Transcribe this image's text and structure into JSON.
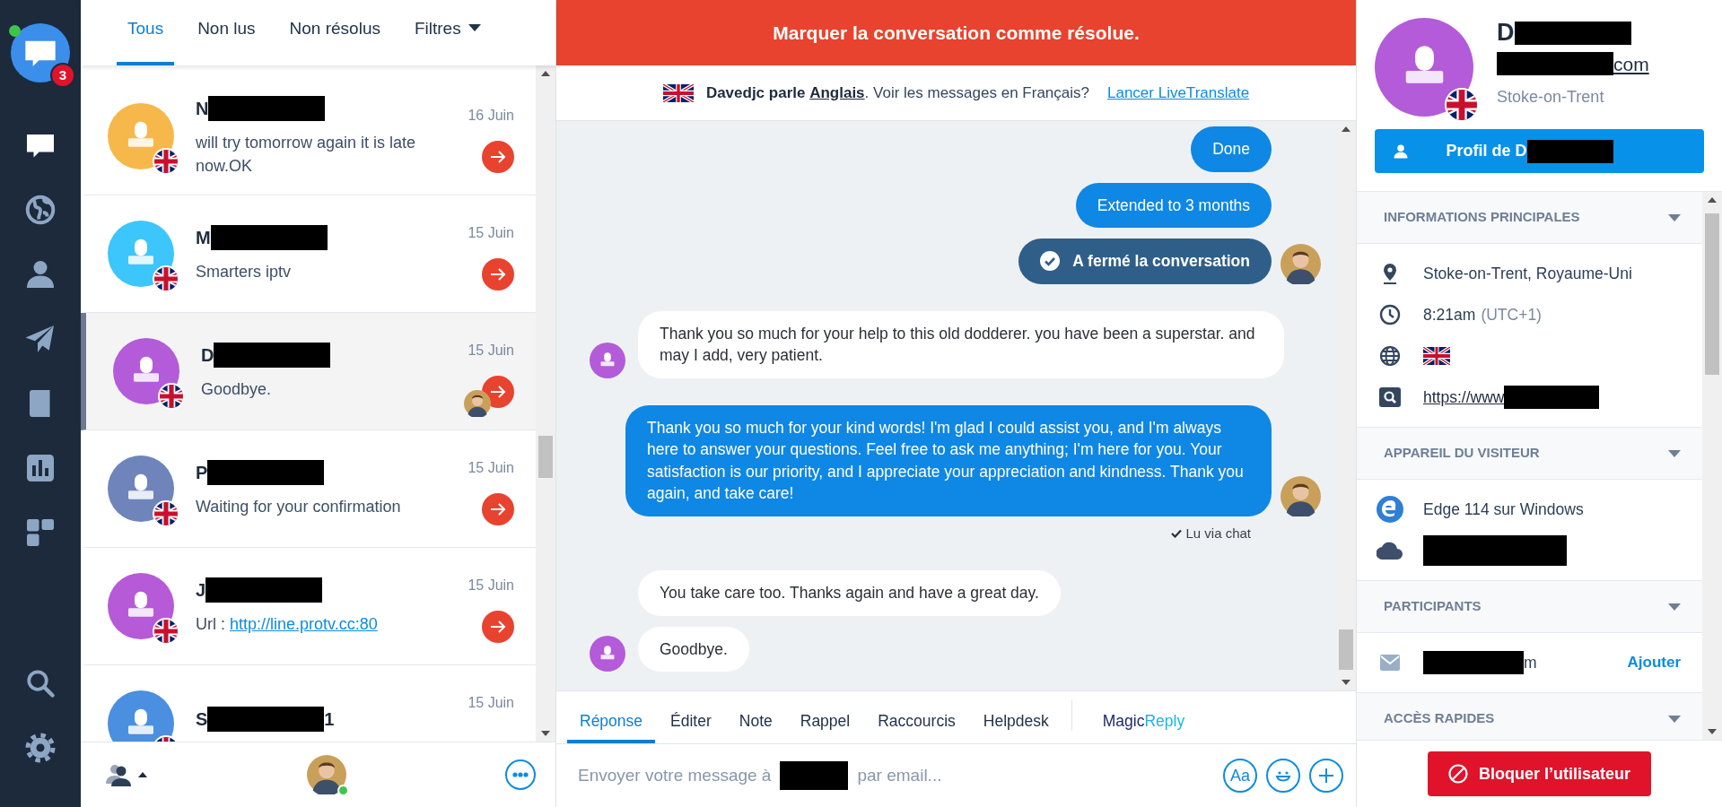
{
  "sidebar": {
    "badge": "3",
    "online": true,
    "items": [
      {
        "kind": "chat",
        "selected": true
      },
      {
        "kind": "globe",
        "selected": false
      },
      {
        "kind": "person",
        "selected": false
      },
      {
        "kind": "plane",
        "selected": false
      },
      {
        "kind": "book",
        "selected": false
      },
      {
        "kind": "chart",
        "selected": false
      },
      {
        "kind": "grid",
        "selected": false
      }
    ],
    "bottom_items": [
      {
        "kind": "search",
        "selected": false
      },
      {
        "kind": "gear",
        "selected": false
      }
    ]
  },
  "conversation_tabs": [
    {
      "label": "Tous",
      "selected": true
    },
    {
      "label": "Non lus",
      "selected": false
    },
    {
      "label": "Non résolus",
      "selected": false
    },
    {
      "label": "Filtres",
      "selected": false,
      "dropdown": true
    }
  ],
  "conversations": [
    {
      "name": "N",
      "redacted": true,
      "date": "16 Juin",
      "message": "will try tomorrow again it is late now.OK",
      "color": "#f7b84b",
      "selected": false,
      "agent_avatar": false
    },
    {
      "name": "M",
      "redacted": true,
      "date": "15 Juin",
      "message": "Smarters iptv",
      "color": "#3cc6fb",
      "selected": false,
      "agent_avatar": false
    },
    {
      "name": "D",
      "redacted": true,
      "date": "15 Juin",
      "message": "Goodbye.",
      "color": "#b45bd9",
      "selected": true,
      "agent_avatar": true
    },
    {
      "name": "P",
      "redacted": true,
      "date": "15 Juin",
      "message": "Waiting for your confirmation",
      "color": "#6f84bb",
      "selected": false,
      "agent_avatar": false
    },
    {
      "name": "J",
      "redacted": true,
      "date": "15 Juin",
      "message": "Url :",
      "link": "http://line.protv.cc:80",
      "color": "#b65ad8",
      "selected": false,
      "agent_avatar": false
    },
    {
      "name": "S",
      "name_end": "1",
      "redacted": true,
      "date": "15 Juin",
      "color": "#4a8fe0",
      "selected": false,
      "agent_avatar": false
    }
  ],
  "list_footer": {
    "agent_online": true
  },
  "resolve_banner": "Marquer la conversation comme résolue.",
  "translate_bar": {
    "text": "**Davedjc parle** **Anglais**. Voir les messages en Français?",
    "link": "Lancer LiveTranslate"
  },
  "messages": [
    {
      "kind": "agent",
      "text": "Done",
      "avatar": false
    },
    {
      "kind": "agent",
      "text": "Extended to 3 months",
      "avatar": false
    },
    {
      "kind": "system",
      "text": "A fermé la conversation",
      "avatar": true
    },
    {
      "kind": "visitor",
      "text": "Thank you so much for your help to this old dodderer. you have been a superstar. and may I add, very patient.",
      "avatar": true
    },
    {
      "kind": "agent",
      "text": "Thank you so much for your kind words! I'm glad I could assist you, and I'm always here to answer your questions. Feel free to ask me anything; I'm here for you. Your satisfaction is our priority, and I appreciate your appreciation and kindness. Thank you again, and take care!",
      "avatar": true
    },
    {
      "kind": "receipt",
      "text": "Lu via chat"
    },
    {
      "kind": "visitor",
      "text": "You take care too. Thanks again and have a great day.",
      "avatar": false
    },
    {
      "kind": "visitor",
      "text": "Goodbye.",
      "avatar": true
    }
  ],
  "reply_tabs": [
    {
      "label": "Réponse",
      "selected": true
    },
    {
      "label": "Éditer",
      "selected": false
    },
    {
      "label": "Note",
      "selected": false
    },
    {
      "label": "Rappel",
      "selected": false
    },
    {
      "label": "Raccourcis",
      "selected": false
    },
    {
      "label": "Helpdesk",
      "selected": false
    },
    {
      "label_parts": [
        "Magic",
        "Reply"
      ],
      "selected": false,
      "divider_before": true
    }
  ],
  "composer": {
    "hint_start": "Envoyer votre message à",
    "hint_end": "par email...",
    "format_button": "Aa"
  },
  "profile": {
    "name": "D",
    "email_end": "com",
    "city": "Stoke-on-Trent",
    "button": "Profil de D"
  },
  "sections": [
    {
      "title": "INFORMATIONS PRINCIPALES",
      "rows": [
        {
          "kind": "location",
          "text": "Stoke-on-Trent, Royaume-Uni"
        },
        {
          "kind": "time",
          "text": "8:21am",
          "note": "(UTC+1)"
        },
        {
          "kind": "language"
        },
        {
          "kind": "website",
          "text": "https://www",
          "redacted": true
        }
      ]
    },
    {
      "title": "APPAREIL DU VISITEUR",
      "rows": [
        {
          "kind": "browser",
          "text": "Edge 114 sur Windows"
        },
        {
          "kind": "network",
          "redacted": true
        }
      ]
    },
    {
      "title": "PARTICIPANTS",
      "rows": [
        {
          "kind": "email",
          "text_end": "m",
          "redacted": true,
          "action": "Ajouter"
        }
      ]
    },
    {
      "title": "ACCÈS RAPIDES"
    }
  ],
  "block_button": "Bloquer l’utilisateur"
}
